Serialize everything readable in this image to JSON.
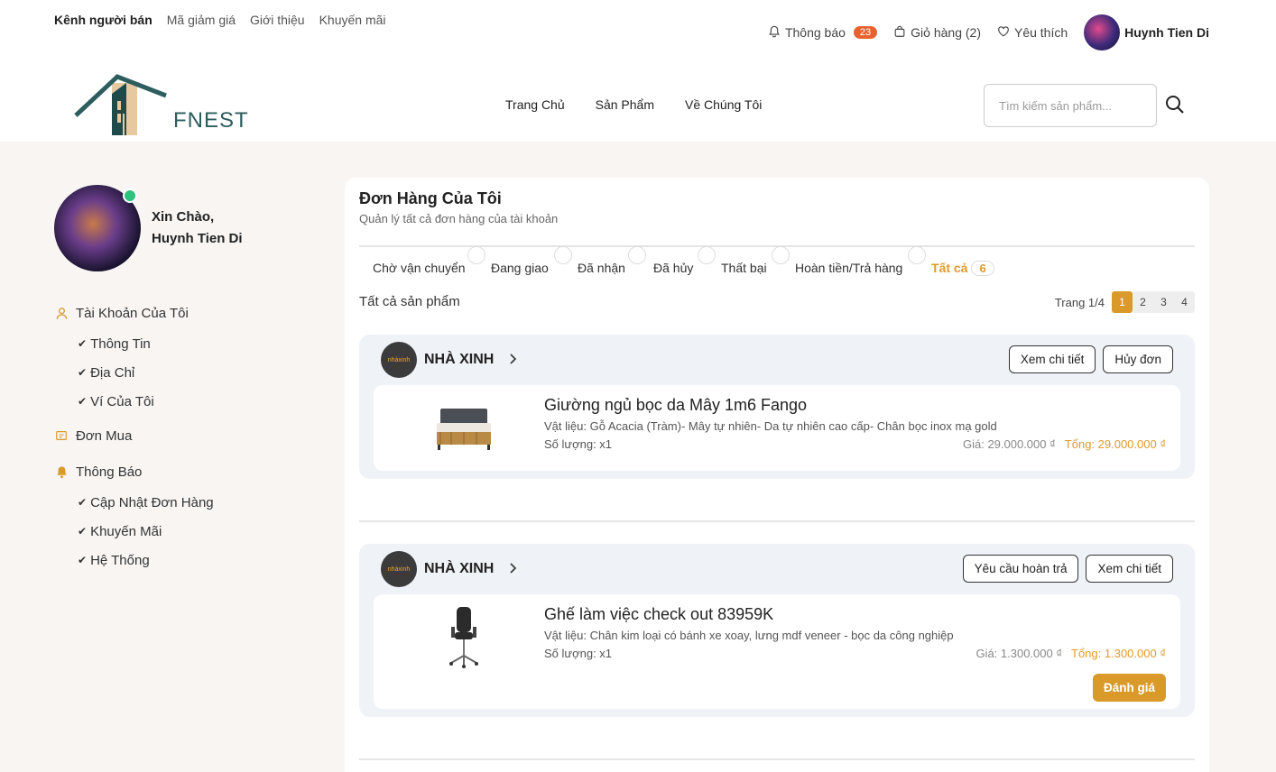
{
  "topbar": {
    "links": [
      "Kênh người bán",
      "Mã giảm giá",
      "Giới thiệu",
      "Khuyến mãi"
    ],
    "notifications_label": "Thông báo",
    "notifications_count": "23",
    "cart_label": "Giỏ hàng (2)",
    "wishlist_label": "Yêu thích",
    "username": "Huynh Tien Di"
  },
  "navbar": {
    "brand": "FNEST",
    "links": [
      "Trang Chủ",
      "Sản Phẩm",
      "Về Chúng Tôi"
    ],
    "search_placeholder": "Tìm kiếm sản phẩm..."
  },
  "sidebar": {
    "greeting": "Xin Chào,",
    "name": "Huynh Tien Di",
    "account_label": "Tài Khoản Của Tôi",
    "account_items": [
      "Thông Tin",
      "Địa Chỉ",
      "Ví Của Tôi"
    ],
    "orders_label": "Đơn Mua",
    "notify_label": "Thông Báo",
    "notify_items": [
      "Cập Nhật Đơn Hàng",
      "Khuyến Mãi",
      "Hệ Thống"
    ]
  },
  "main": {
    "title": "Đơn Hàng Của Tôi",
    "subtitle": "Quản lý tất cả đơn hàng của tài khoản",
    "tabs": [
      "Chờ vận chuyển",
      "Đang giao",
      "Đã nhận",
      "Đã hủy",
      "Thất bại",
      "Hoàn tiền/Trả hàng",
      "Tất cả"
    ],
    "all_count": "6",
    "all_products_label": "Tất cả sản phẩm",
    "page_label": "Trang 1/4",
    "pages": [
      "1",
      "2",
      "3",
      "4"
    ],
    "current_page": "1"
  },
  "orders": [
    {
      "shop": "NHÀ XINH",
      "shop_logo_text": "nhàxinh",
      "buttons": [
        "Xem chi tiết",
        "Hủy đơn"
      ],
      "product": "Giường ngủ bọc da Mây 1m6 Fango",
      "material": "Vật liệu: Gỗ Acacia (Tràm)- Mây tự nhiên- Da tự nhiên cao cấp- Chân bọc inox mạ gold",
      "quantity": "Số lượng: x1",
      "price": "Giá: 29.000.000 ₫",
      "total": "Tổng: 29.000.000 ₫"
    },
    {
      "shop": "NHÀ XINH",
      "shop_logo_text": "nhàxinh",
      "buttons": [
        "Yêu cầu hoàn trả",
        "Xem chi tiết"
      ],
      "product": "Ghế làm việc check out 83959K",
      "material": "Vật liệu: Chân kim loại có bánh xe xoay, lưng mdf veneer - bọc da công nghiệp",
      "quantity": "Số lượng: x1",
      "price": "Giá: 1.300.000 ₫",
      "total": "Tổng: 1.300.000 ₫",
      "rate_label": "Đánh giá"
    }
  ],
  "colors": {
    "accent": "#d99a2a",
    "badge": "#e8622f",
    "online": "#2ec27e",
    "brand": "#2d5d5e"
  }
}
